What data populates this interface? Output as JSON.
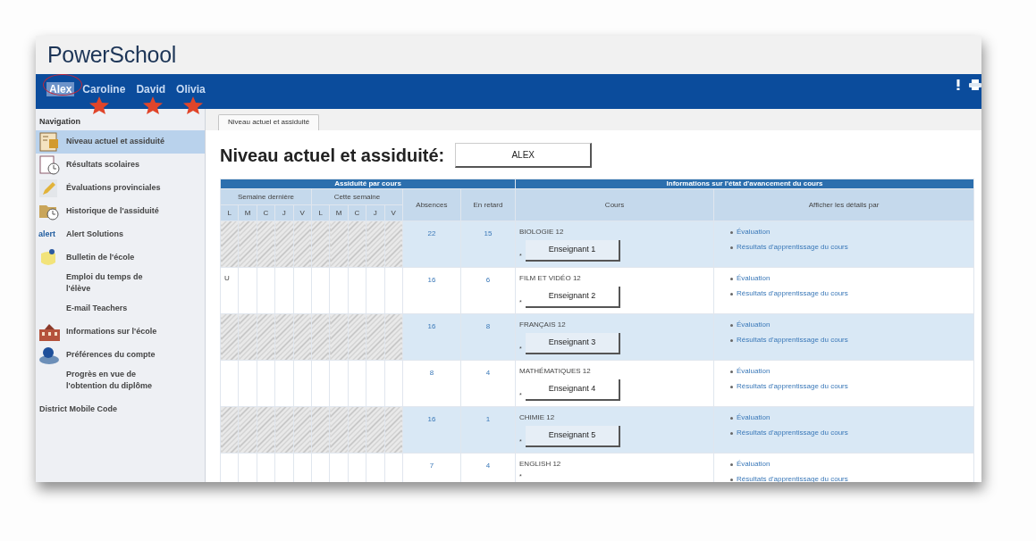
{
  "app": {
    "logo": "PowerSchool"
  },
  "students": [
    {
      "name": "Alex",
      "selected": true,
      "circled": true,
      "starred": false
    },
    {
      "name": "Caroline",
      "selected": false,
      "circled": false,
      "starred": true
    },
    {
      "name": "David",
      "selected": false,
      "circled": false,
      "starred": true
    },
    {
      "name": "Olivia",
      "selected": false,
      "circled": false,
      "starred": true
    }
  ],
  "sidebar": {
    "title": "Navigation",
    "items": [
      {
        "label": "Niveau actuel et assiduité",
        "kind": "grades",
        "selected": true
      },
      {
        "label": "Résultats scolaires",
        "kind": "results",
        "selected": false
      },
      {
        "label": "Évaluations provinciales",
        "kind": "pencil",
        "selected": false
      },
      {
        "label": "Historique de l'assiduité",
        "kind": "history",
        "selected": false
      },
      {
        "label": "Alert Solutions",
        "kind": "alert",
        "logo_text": "alert",
        "selected": false
      },
      {
        "label": "Bulletin de l'école",
        "kind": "bulletin",
        "selected": false
      },
      {
        "label": "Emploi du temps de l'élève",
        "kind": "plain",
        "selected": false
      },
      {
        "label": "E-mail Teachers",
        "kind": "plain",
        "selected": false
      },
      {
        "label": "Informations sur l'école",
        "kind": "school",
        "selected": false
      },
      {
        "label": "Préférences du compte",
        "kind": "account",
        "selected": false
      },
      {
        "label": "Progrès en vue de l'obtention du diplôme",
        "kind": "plain",
        "selected": false
      }
    ],
    "footer": "District Mobile Code"
  },
  "tabs": [
    {
      "label": "Niveau actuel et assiduité",
      "selected": true
    }
  ],
  "page": {
    "heading": "Niveau actuel et assiduité:",
    "student_button": "ALEX"
  },
  "table": {
    "group_headers": [
      "Assiduité par cours",
      "Informations sur l'état d'avancement du cours"
    ],
    "last_week": "Semaine dernière",
    "this_week": "Cette semaine",
    "days": [
      "L",
      "M",
      "C",
      "J",
      "V",
      "L",
      "M",
      "C",
      "J",
      "V"
    ],
    "columns": [
      "Absences",
      "En retard",
      "Cours",
      "Afficher les détails par"
    ],
    "rows": [
      {
        "hatched": true,
        "absences": "22",
        "late": "15",
        "course": "BIOLOGIE 12",
        "teacher_note": "*",
        "teacher": "Enseignant 1",
        "links": [
          "Évaluation",
          "Résultats d'apprentissage du cours"
        ]
      },
      {
        "hatched": false,
        "day_codes": [
          "U"
        ],
        "absences": "16",
        "late": "6",
        "course": "FILM ET VIDÉO 12",
        "teacher_note": "*",
        "teacher": "Enseignant 2",
        "links": [
          "Évaluation",
          "Résultats d'apprentissage du cours"
        ]
      },
      {
        "hatched": true,
        "absences": "16",
        "late": "8",
        "course": "FRANÇAIS 12",
        "teacher_note": "*",
        "teacher": "Enseignant 3",
        "links": [
          "Évaluation",
          "Résultats d'apprentissage du cours"
        ]
      },
      {
        "hatched": false,
        "absences": "8",
        "late": "4",
        "course": "MATHÉMATIQUES 12",
        "teacher_note": "*",
        "teacher": "Enseignant 4",
        "links": [
          "Évaluation",
          "Résultats d'apprentissage du cours"
        ]
      },
      {
        "hatched": true,
        "absences": "16",
        "late": "1",
        "course": "CHIMIE 12",
        "teacher_note": "*",
        "teacher": "Enseignant 5",
        "links": [
          "Évaluation",
          "Résultats d'apprentissage du cours"
        ]
      },
      {
        "hatched": false,
        "absences": "7",
        "late": "4",
        "course": "ENGLISH 12",
        "teacher_note": "*",
        "links": [
          "Évaluation",
          "Résultats d'apprentissage du cours"
        ]
      }
    ]
  }
}
